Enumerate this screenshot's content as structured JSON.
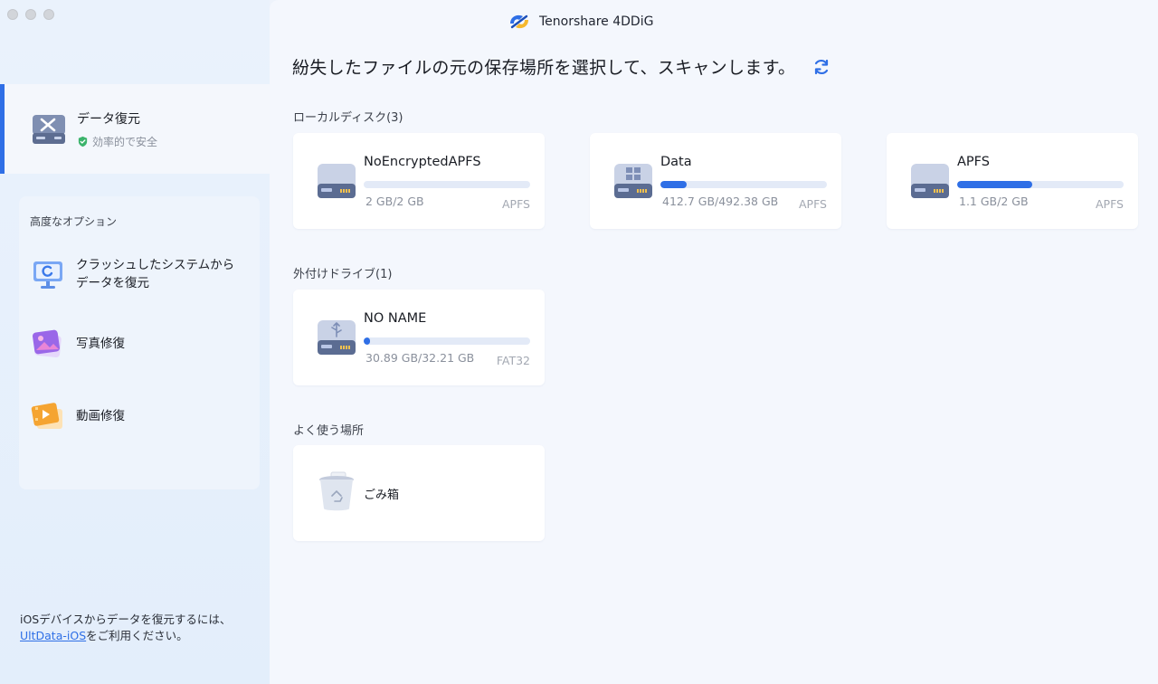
{
  "window": {
    "app_title": "Tenorshare 4DDiG"
  },
  "sidebar": {
    "recovery": {
      "title": "データ復元",
      "subtitle": "効率的で安全"
    },
    "advanced": {
      "heading": "高度なオプション",
      "items": [
        {
          "label_line1": "クラッシュしたシステムから",
          "label_line2": "データを復元",
          "icon": "monitor-restore-icon"
        },
        {
          "label_line1": "写真修復",
          "icon": "photo-repair-icon"
        },
        {
          "label_line1": "動画修復",
          "icon": "video-repair-icon"
        }
      ]
    },
    "ios_note": {
      "line1": "iOSデバイスからデータを復元するには、",
      "link": "UltData-iOS",
      "line2_rest": "をご利用ください。"
    }
  },
  "main": {
    "headline": "紛失したファイルの元の保存場所を選択して、スキャンします。",
    "local_disks": {
      "label": "ローカルディスク(3)",
      "items": [
        {
          "name": "NoEncryptedAPFS",
          "size": "2 GB/2 GB",
          "fs": "APFS",
          "usage": 0.0
        },
        {
          "name": "Data",
          "size": "412.7 GB/492.38 GB",
          "fs": "APFS",
          "usage": 0.16
        },
        {
          "name": "APFS",
          "size": "1.1 GB/2 GB",
          "fs": "APFS",
          "usage": 0.45
        }
      ]
    },
    "external": {
      "label": "外付けドライブ(1)",
      "items": [
        {
          "name": "NO NAME",
          "size": "30.89 GB/32.21 GB",
          "fs": "FAT32",
          "usage": 0.04
        }
      ]
    },
    "common": {
      "label": "よく使う場所",
      "items": [
        {
          "name": "ごみ箱"
        }
      ]
    }
  },
  "colors": {
    "accent": "#2f6fe6",
    "track": "#e3eaf7"
  }
}
